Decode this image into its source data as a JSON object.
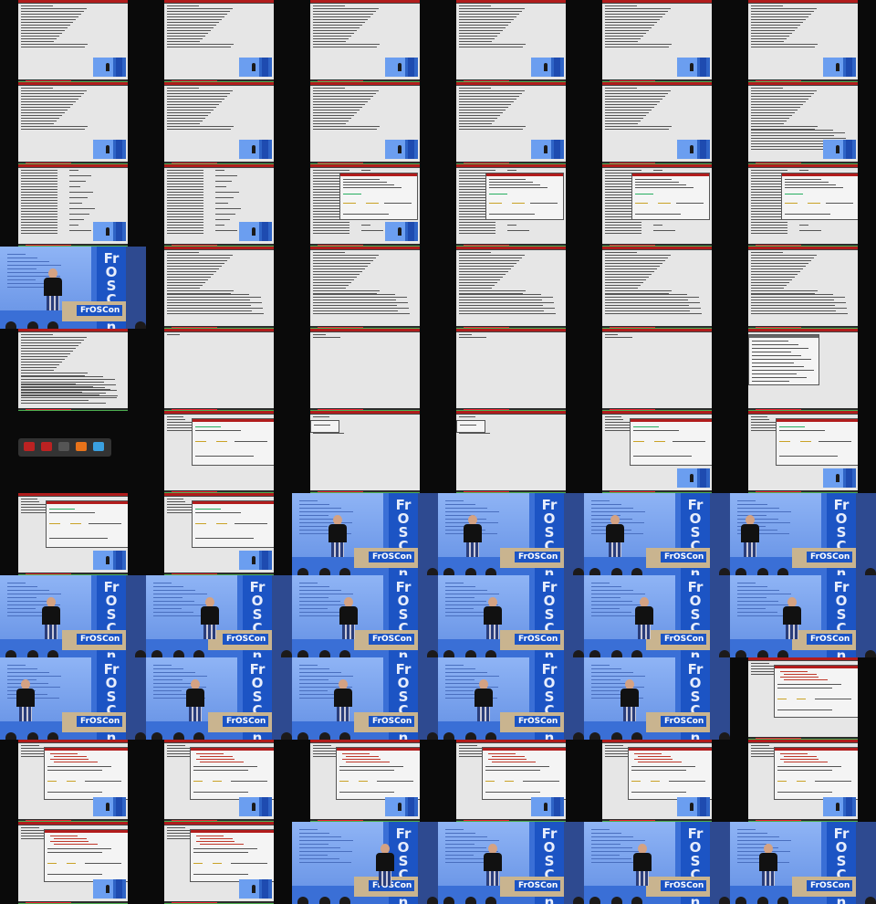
{
  "page": {
    "title": "",
    "background": "#0a0a0a"
  },
  "grid": {
    "columns": 6,
    "rows": 11
  },
  "stage_text": {
    "banner": "FrOSCon",
    "podium_logo": "FrOSCon"
  },
  "cells": [
    {
      "kind": "term",
      "pip": true
    },
    {
      "kind": "term",
      "pip": true
    },
    {
      "kind": "term",
      "pip": true
    },
    {
      "kind": "term",
      "pip": true
    },
    {
      "kind": "term",
      "pip": true
    },
    {
      "kind": "term",
      "pip": true
    },
    {
      "kind": "term",
      "pip": true
    },
    {
      "kind": "term",
      "pip": true,
      "sel": true
    },
    {
      "kind": "term",
      "pip": true
    },
    {
      "kind": "term",
      "pip": true
    },
    {
      "kind": "term",
      "pip": true
    },
    {
      "kind": "term",
      "pip": true,
      "wide": true
    },
    {
      "kind": "cols",
      "pip": true
    },
    {
      "kind": "cols",
      "pip": true
    },
    {
      "kind": "cols",
      "pip": true,
      "dialog": true
    },
    {
      "kind": "cols",
      "dialog": true
    },
    {
      "kind": "cols",
      "dialog": true
    },
    {
      "kind": "cols",
      "dialog2": true
    },
    {
      "kind": "stage",
      "slide": true,
      "person": 48,
      "pose": "down"
    },
    {
      "kind": "term",
      "wide": true
    },
    {
      "kind": "term",
      "wide": true
    },
    {
      "kind": "term",
      "wide": true
    },
    {
      "kind": "term",
      "wide": true
    },
    {
      "kind": "term",
      "wide": true
    },
    {
      "kind": "term",
      "wide": true,
      "tall": true
    },
    {
      "kind": "blank"
    },
    {
      "kind": "blank",
      "tabs": true
    },
    {
      "kind": "blank",
      "tabs": true
    },
    {
      "kind": "blank",
      "tabs": true
    },
    {
      "kind": "menu"
    },
    {
      "kind": "dock"
    },
    {
      "kind": "diag",
      "dialog": true
    },
    {
      "kind": "small"
    },
    {
      "kind": "small"
    },
    {
      "kind": "diag",
      "pip": true
    },
    {
      "kind": "diag",
      "pip": true,
      "dialog": true
    },
    {
      "kind": "diag",
      "pip": true
    },
    {
      "kind": "diag",
      "pip": true
    },
    {
      "kind": "stage",
      "person": 40
    },
    {
      "kind": "stage",
      "person": 28
    },
    {
      "kind": "stage",
      "person": 24
    },
    {
      "kind": "stage",
      "person": 12
    },
    {
      "kind": "stage",
      "person": 46
    },
    {
      "kind": "stage",
      "person": 60
    },
    {
      "kind": "stage",
      "person": 52
    },
    {
      "kind": "stage",
      "person": 50
    },
    {
      "kind": "stage",
      "person": 56
    },
    {
      "kind": "stage",
      "person": 58
    },
    {
      "kind": "stage",
      "person": 18
    },
    {
      "kind": "stage",
      "person": 44
    },
    {
      "kind": "stage",
      "person": 46
    },
    {
      "kind": "stage",
      "person": 40
    },
    {
      "kind": "stage",
      "person": 40
    },
    {
      "kind": "code"
    },
    {
      "kind": "code",
      "pip": true
    },
    {
      "kind": "code",
      "pip": true
    },
    {
      "kind": "code",
      "pip": true
    },
    {
      "kind": "code",
      "pip": true
    },
    {
      "kind": "code",
      "pip": true
    },
    {
      "kind": "code",
      "pip": true
    },
    {
      "kind": "code",
      "pip": true
    },
    {
      "kind": "code",
      "pip": true
    },
    {
      "kind": "stage",
      "person": 92,
      "pose": "point"
    },
    {
      "kind": "stage",
      "person": 50
    },
    {
      "kind": "stage",
      "person": 54
    },
    {
      "kind": "stage",
      "person": 32
    }
  ],
  "colors": {
    "terminal_bg": "#e6e6e6",
    "tmux_red": "#b11c1c",
    "status_green": "#4caf50",
    "slide_blue": "#6d98e8",
    "banner_blue": "#1c54c4",
    "podium": "#c9b48f"
  }
}
